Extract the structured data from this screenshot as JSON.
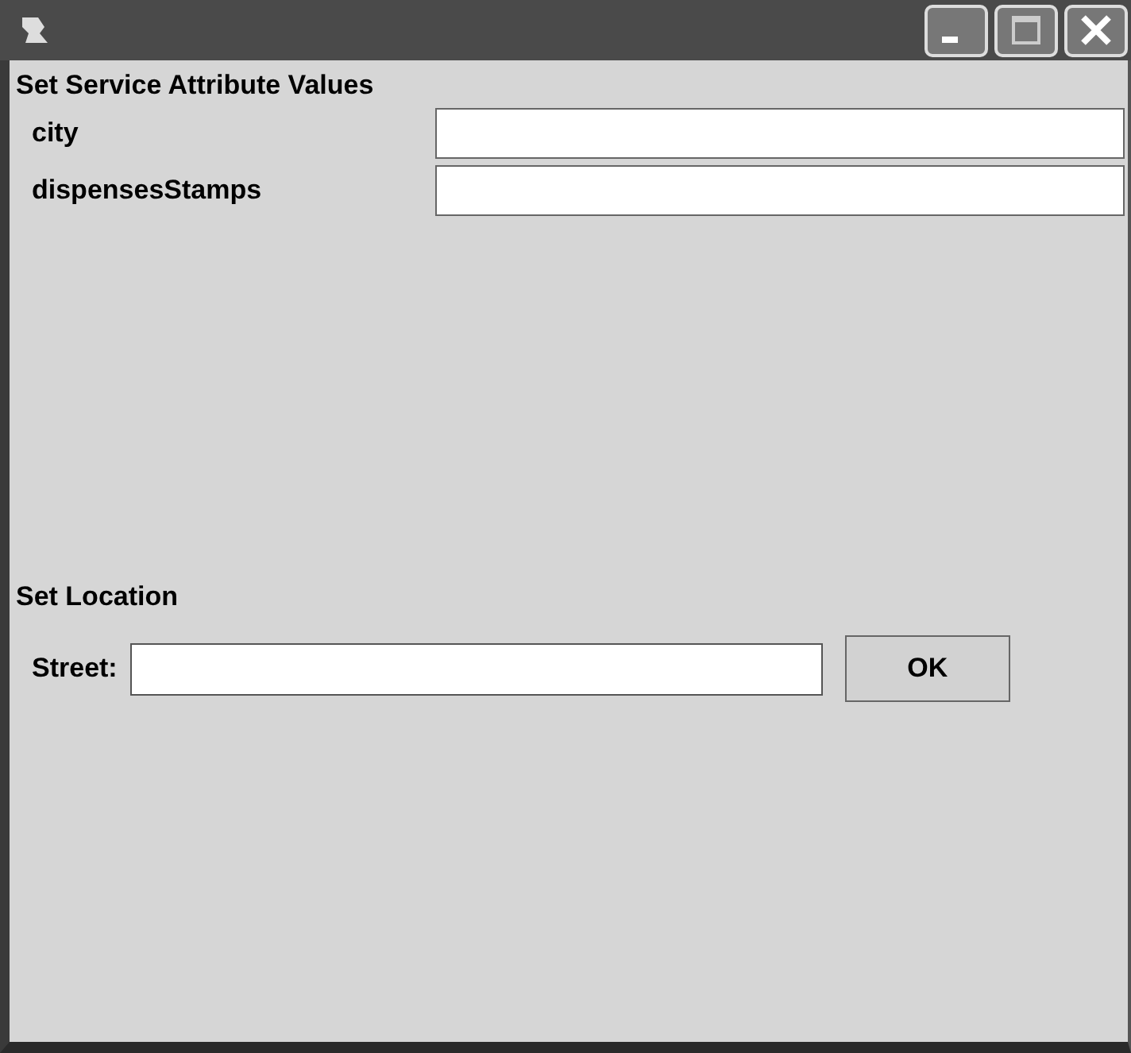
{
  "attributes": {
    "title": "Set Service Attribute Values",
    "fields": [
      {
        "label": "city"
      },
      {
        "label": "dispensesStamps"
      }
    ]
  },
  "location": {
    "title": "Set Location",
    "label": "Street:",
    "button": "OK"
  }
}
